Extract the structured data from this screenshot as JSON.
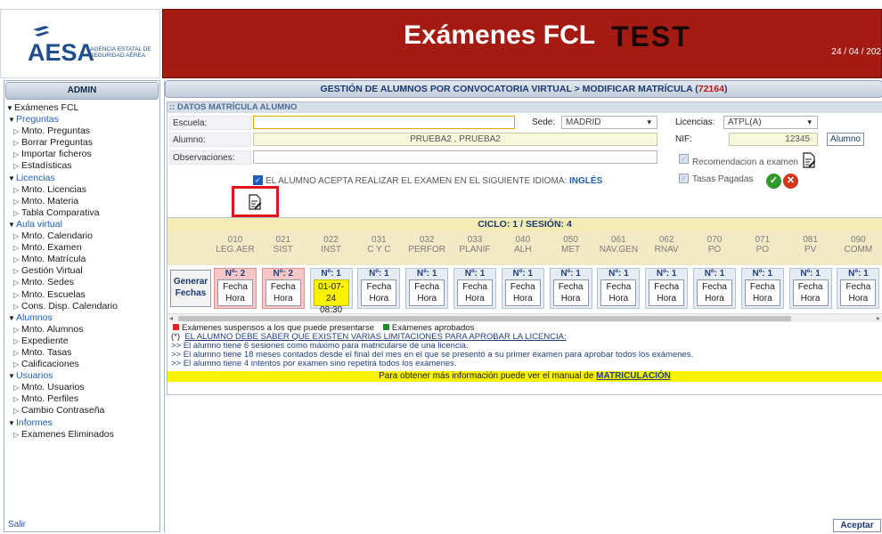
{
  "header": {
    "logo_text": "AESA",
    "logo_subtitle": "Agencia Estatal de Seguridad Aérea",
    "title": "Exámenes FCL",
    "env": "TEST",
    "date": "24 / 04 / 202",
    "band_color": "#a41b13"
  },
  "menu": {
    "head": "ADMIN",
    "items": [
      {
        "label": "Exámenes FCL",
        "level": 0,
        "arrow": "down"
      },
      {
        "label": "Preguntas",
        "level": 1,
        "arrow": "down"
      },
      {
        "label": "Mnto. Preguntas",
        "level": 2,
        "arrow": "right"
      },
      {
        "label": "Borrar Preguntas",
        "level": 2,
        "arrow": "right"
      },
      {
        "label": "Importar ficheros",
        "level": 2,
        "arrow": "right"
      },
      {
        "label": "Estadísticas",
        "level": 2,
        "arrow": "right"
      },
      {
        "label": "Licencias",
        "level": 1,
        "arrow": "down"
      },
      {
        "label": "Mnto. Licencias",
        "level": 2,
        "arrow": "right"
      },
      {
        "label": "Mnto. Materia",
        "level": 2,
        "arrow": "right"
      },
      {
        "label": "Tabla Comparativa",
        "level": 2,
        "arrow": "right"
      },
      {
        "label": "Aula virtual",
        "level": 1,
        "arrow": "down"
      },
      {
        "label": "Mnto. Calendario",
        "level": 2,
        "arrow": "right"
      },
      {
        "label": "Mnto. Examen",
        "level": 2,
        "arrow": "right"
      },
      {
        "label": "Mnto. Matrícula",
        "level": 2,
        "arrow": "right"
      },
      {
        "label": "Gestión Virtual",
        "level": 2,
        "arrow": "right"
      },
      {
        "label": "Mnto. Sedes",
        "level": 2,
        "arrow": "right"
      },
      {
        "label": "Mnto. Escuelas",
        "level": 2,
        "arrow": "right"
      },
      {
        "label": "Cons. Disp. Calendario",
        "level": 2,
        "arrow": "right"
      },
      {
        "label": "Alumnos",
        "level": 1,
        "arrow": "down"
      },
      {
        "label": "Mnto. Alumnos",
        "level": 2,
        "arrow": "right"
      },
      {
        "label": "Expediente",
        "level": 2,
        "arrow": "right"
      },
      {
        "label": "Mnto. Tasas",
        "level": 2,
        "arrow": "right"
      },
      {
        "label": "Calificaciones",
        "level": 2,
        "arrow": "right"
      },
      {
        "label": "Usuarios",
        "level": 1,
        "arrow": "down"
      },
      {
        "label": "Mnto. Usuarios",
        "level": 2,
        "arrow": "right"
      },
      {
        "label": "Mnto. Perfiles",
        "level": 2,
        "arrow": "right"
      },
      {
        "label": "Cambio Contraseña",
        "level": 2,
        "arrow": "right"
      },
      {
        "label": "Informes",
        "level": 1,
        "arrow": "down"
      },
      {
        "label": "Examenes Eliminados",
        "level": 2,
        "arrow": "right"
      }
    ],
    "salir": "Salir"
  },
  "breadcrumb": {
    "text": "GESTIÓN DE ALUMNOS POR CONVOCATORIA VIRTUAL > MODIFICAR MATRÍCULA (",
    "id": "72164",
    "close": ")"
  },
  "form": {
    "section_title": ":: DATOS MATRÍCULA ALUMNO",
    "escuela_label": "Escuela:",
    "escuela_value": "",
    "sede_label": "Sede:",
    "sede_value": "MADRID",
    "licencias_label": "Licencias:",
    "licencias_value": "ATPL(A)",
    "alumno_label": "Alumno:",
    "alumno_value": "PRUEBA2 , PRUEBA2",
    "nif_label": "NIF:",
    "nif_value": "12345",
    "alumno_button": "Alumno",
    "observaciones_label": "Observaciones:",
    "observaciones_value": "",
    "recomendacion_label": "Recomendacion a examen",
    "idioma_text": "EL ALUMNO ACEPTA REALIZAR EL EXAMEN EN EL SIGUIENTE IDIOMA:",
    "idioma_value": "INGLÉS",
    "tasas_label": "Tasas Pagadas"
  },
  "exams": {
    "cycle_text": "CICLO: 1 / SESIÓN: 4",
    "generar_label": "Generar Fechas",
    "subjects": [
      {
        "code": "010",
        "name": "LEG.AER",
        "n": "Nº: 2",
        "fh1": "Fecha",
        "fh2": "Hora",
        "state": "failed"
      },
      {
        "code": "021",
        "name": "SIST",
        "n": "Nº: 2",
        "fh1": "Fecha",
        "fh2": "Hora",
        "state": "failed"
      },
      {
        "code": "022",
        "name": "INST",
        "n": "Nº: 1",
        "fh1": "01-07-24",
        "fh2": "08:30",
        "state": "date"
      },
      {
        "code": "031",
        "name": "C Y C",
        "n": "Nº: 1",
        "fh1": "Fecha",
        "fh2": "Hora",
        "state": ""
      },
      {
        "code": "032",
        "name": "PERFOR",
        "n": "Nº: 1",
        "fh1": "Fecha",
        "fh2": "Hora",
        "state": ""
      },
      {
        "code": "033",
        "name": "PLANIF",
        "n": "Nº: 1",
        "fh1": "Fecha",
        "fh2": "Hora",
        "state": ""
      },
      {
        "code": "040",
        "name": "ALH",
        "n": "Nº: 1",
        "fh1": "Fecha",
        "fh2": "Hora",
        "state": ""
      },
      {
        "code": "050",
        "name": "MET",
        "n": "Nº: 1",
        "fh1": "Fecha",
        "fh2": "Hora",
        "state": ""
      },
      {
        "code": "061",
        "name": "NAV.GEN",
        "n": "Nº: 1",
        "fh1": "Fecha",
        "fh2": "Hora",
        "state": ""
      },
      {
        "code": "062",
        "name": "RNAV",
        "n": "Nº: 1",
        "fh1": "Fecha",
        "fh2": "Hora",
        "state": ""
      },
      {
        "code": "070",
        "name": "PO",
        "n": "Nº: 1",
        "fh1": "Fecha",
        "fh2": "Hora",
        "state": ""
      },
      {
        "code": "071",
        "name": "PO",
        "n": "Nº: 1",
        "fh1": "Fecha",
        "fh2": "Hora",
        "state": ""
      },
      {
        "code": "081",
        "name": "PV",
        "n": "Nº: 1",
        "fh1": "Fecha",
        "fh2": "Hora",
        "state": ""
      },
      {
        "code": "090",
        "name": "COMM",
        "n": "Nº: 1",
        "fh1": "Fecha",
        "fh2": "Hora",
        "state": ""
      }
    ],
    "legend_failed": "Exámenes suspensos a los que puede presentarse",
    "legend_passed": "Exámenes aprobados",
    "legend_failed_color": "#e0231b",
    "legend_passed_color": "#1f8c2a",
    "warning": "EL ALUMNO DEBE SABER QUE EXISTEN VARIAS LIMITACIONES PARA APROBAR LA LICENCIA:",
    "warning_prefix": "(*)",
    "lines": [
      ">> El alumno tiene 6 sesiones como máximo para matricularse de una licencia.",
      ">> El alumno tiene 18 meses contados desde el final del mes en el que se presentó a su primer examen para aprobar todos los exámenes.",
      ">> El alumno tiene 4 intentos por examen sino repetirá todos los exámenes."
    ],
    "manual_text": "Para obtener más información puede ver el manual de",
    "manual_link": "MATRICULACIÓN"
  },
  "footer": {
    "aceptar": "Aceptar"
  }
}
